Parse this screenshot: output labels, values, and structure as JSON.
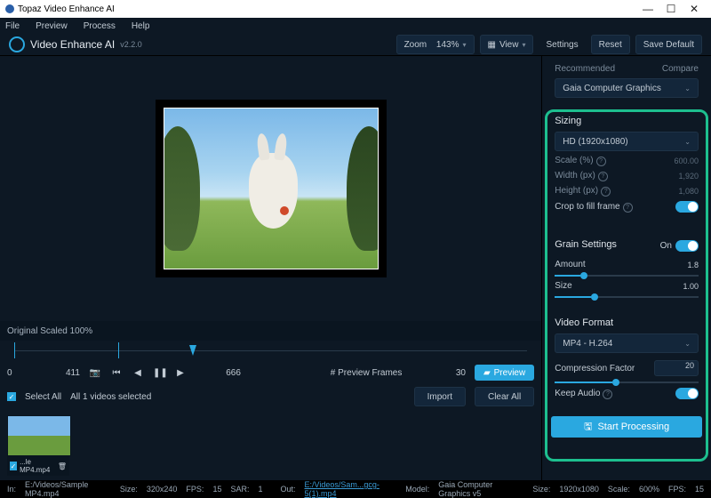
{
  "window_title": "Topaz Video Enhance AI",
  "menu": {
    "file": "File",
    "preview": "Preview",
    "process": "Process",
    "help": "Help"
  },
  "header": {
    "app": "Video Enhance AI",
    "version": "v2.2.0",
    "zoom_lbl": "Zoom",
    "zoom_val": "143%",
    "view": "View",
    "settings": "Settings",
    "reset": "Reset",
    "save_default": "Save Default"
  },
  "recommended": "Recommended",
  "compare": "Compare",
  "model": "Gaia Computer Graphics",
  "sizing": {
    "title": "Sizing",
    "preset": "HD (1920x1080)",
    "scale_lbl": "Scale (%)",
    "scale_val": "600.00",
    "width_lbl": "Width (px)",
    "width_val": "1,920",
    "height_lbl": "Height (px)",
    "height_val": "1,080",
    "crop_lbl": "Crop to fill frame"
  },
  "grain": {
    "title": "Grain Settings",
    "on": "On",
    "amount_lbl": "Amount",
    "amount_val": "1.8",
    "size_lbl": "Size",
    "size_val": "1.00"
  },
  "format": {
    "title": "Video Format",
    "codec": "MP4 - H.264",
    "comp_lbl": "Compression Factor",
    "comp_val": "20",
    "keep_audio": "Keep Audio"
  },
  "start": "Start Processing",
  "scale_text": "Original Scaled 100%",
  "timeline": {
    "start": "0",
    "cur": "411",
    "end": "666",
    "frames_lbl": "# Preview Frames",
    "frames_val": "30",
    "preview": "Preview"
  },
  "sel": {
    "select_all": "Select All",
    "count": "All 1 videos selected",
    "import": "Import",
    "clear": "Clear All"
  },
  "card": {
    "name": "...le MP4.mp4"
  },
  "status": {
    "in_lbl": "In:",
    "in": "E:/Videos/Sample MP4.mp4",
    "size_lbl": "Size:",
    "size": "320x240",
    "fps_lbl": "FPS:",
    "fps": "15",
    "sar_lbl": "SAR:",
    "sar": "1",
    "out_lbl": "Out:",
    "out": "E:/Videos/Sam...gcg-5(1).mp4",
    "model_lbl": "Model:",
    "model": "Gaia Computer Graphics v5",
    "osize": "1920x1080",
    "scale_lbl": "Scale:",
    "scale": "600%",
    "ofps": "15"
  }
}
